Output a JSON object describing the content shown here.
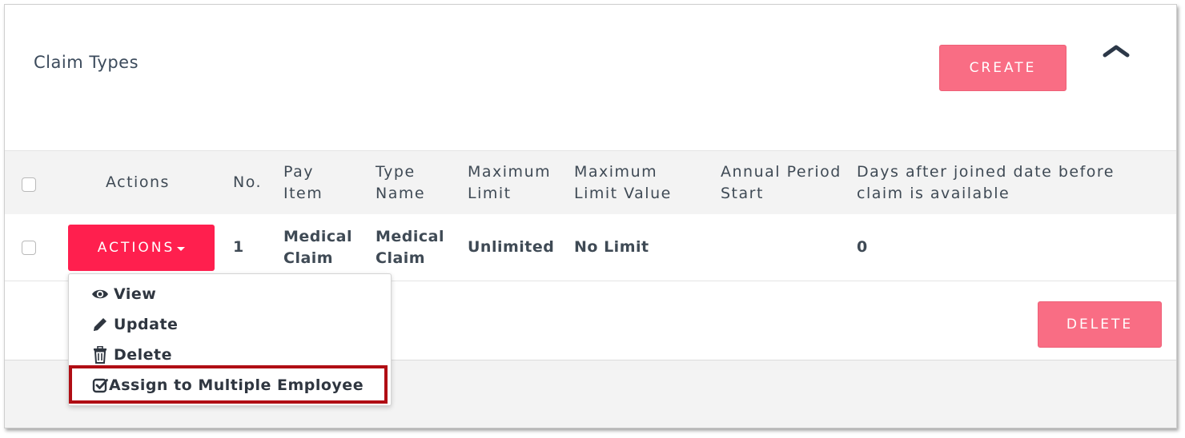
{
  "header": {
    "title": "Claim Types",
    "create_label": "CREATE",
    "delete_label": "DELETE"
  },
  "table": {
    "columns": [
      "Actions",
      "No.",
      "Pay Item",
      "Type Name",
      "Maximum Limit",
      "Maximum Limit Value",
      "Annual Period Start",
      "Days after joined date before claim is available"
    ],
    "rows": [
      {
        "actions_label": "ACTIONS",
        "no": "1",
        "pay_item": "Medical Claim",
        "type_name": "Medical Claim",
        "maximum_limit": "Unlimited",
        "maximum_limit_value": "No Limit",
        "annual_period_start": "",
        "days_after_joined": "0"
      }
    ]
  },
  "actions_menu": {
    "items": [
      {
        "label": "View",
        "icon": "eye-icon"
      },
      {
        "label": "Update",
        "icon": "pencil-icon"
      },
      {
        "label": "Delete",
        "icon": "trash-icon"
      },
      {
        "label": "Assign to Multiple Employee",
        "icon": "check-square-icon"
      }
    ]
  },
  "colors": {
    "primary_button": "#f96d84",
    "actions_button": "#ff1f4e",
    "highlight": "#b00d14",
    "title_text": "#3c4b5c"
  }
}
